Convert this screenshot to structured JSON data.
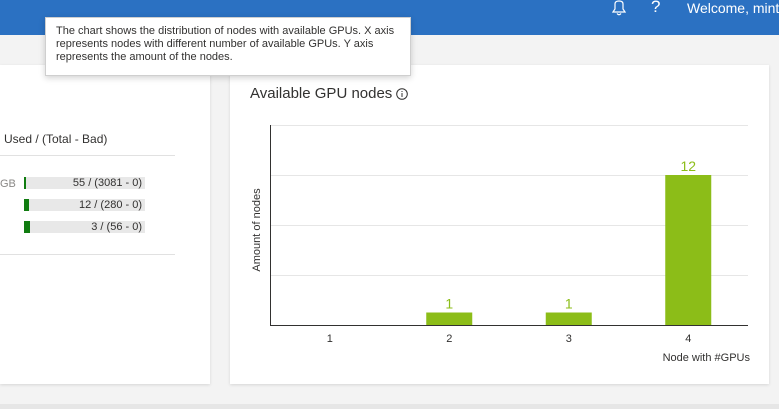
{
  "header": {
    "help_label": "?",
    "welcome_text": "Welcome, mint"
  },
  "icons": {
    "bell": "bell-icon",
    "help": "help-icon",
    "info": "info-icon"
  },
  "resources": {
    "column_header": "Used / (Total - Bad)",
    "rows": [
      {
        "label": "GB",
        "value_text": "55 / (3081 - 0)",
        "used": 55,
        "total": 3081
      },
      {
        "label": "",
        "value_text": "12 / (280 - 0)",
        "used": 12,
        "total": 280
      },
      {
        "label": "",
        "value_text": "3 / (56 - 0)",
        "used": 3,
        "total": 56
      }
    ]
  },
  "gpu_card": {
    "title": "Available GPU nodes"
  },
  "tooltip": {
    "text": "The chart shows the distribution of nodes with available GPUs. X axis represents nodes with different number of available GPUs. Y axis represents the amount of the nodes."
  },
  "colors": {
    "header": "#2b71c2",
    "bar_fill": "#8cbd18",
    "resource_fill": "#107c10"
  },
  "chart_data": {
    "type": "bar",
    "title": "Available GPU nodes",
    "categories": [
      "1",
      "2",
      "3",
      "4"
    ],
    "values": [
      0,
      1,
      1,
      12
    ],
    "data_labels": [
      "",
      "1",
      "1",
      "12"
    ],
    "xlabel": "Node with #GPUs",
    "ylabel": "Amount of nodes",
    "ylim": [
      0,
      16
    ],
    "grid": true
  }
}
